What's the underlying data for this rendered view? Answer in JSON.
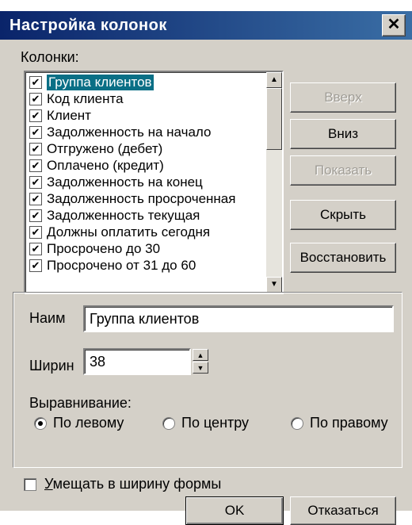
{
  "window": {
    "title": "Настройка колонок",
    "close_symbol": "✕"
  },
  "columns_label": "Колонки:",
  "columns": [
    {
      "label": "Группа клиентов",
      "checked": true,
      "selected": true
    },
    {
      "label": "Код клиента",
      "checked": true
    },
    {
      "label": "Клиент",
      "checked": true
    },
    {
      "label": "Задолженность на начало",
      "checked": true
    },
    {
      "label": "Отгружено (дебет)",
      "checked": true
    },
    {
      "label": "Оплачено (кредит)",
      "checked": true
    },
    {
      "label": "Задолженность на конец",
      "checked": true
    },
    {
      "label": "Задолженность просроченная",
      "checked": true
    },
    {
      "label": "Задолженность текущая",
      "checked": true
    },
    {
      "label": "Должны оплатить сегодня",
      "checked": true
    },
    {
      "label": "Просрочено до 30",
      "checked": true
    },
    {
      "label": "Просрочено от 31 до 60",
      "checked": true
    }
  ],
  "side_buttons": {
    "up": "Вверх",
    "down": "Вниз",
    "show": "Показать",
    "hide": "Скрыть",
    "restore": "Восстановить"
  },
  "props": {
    "name_label": "Наим",
    "name_value": "Группа клиентов",
    "width_label": "Ширин",
    "width_value": "38",
    "align_label": "Выравнивание:",
    "align_left": "По левому",
    "align_center": "По центру",
    "align_right": "По правому",
    "align_selected": "left"
  },
  "fit_width_label": "Умещать в ширину формы",
  "fit_width_checked": false,
  "ok_label": "OK",
  "cancel_label": "Отказаться"
}
